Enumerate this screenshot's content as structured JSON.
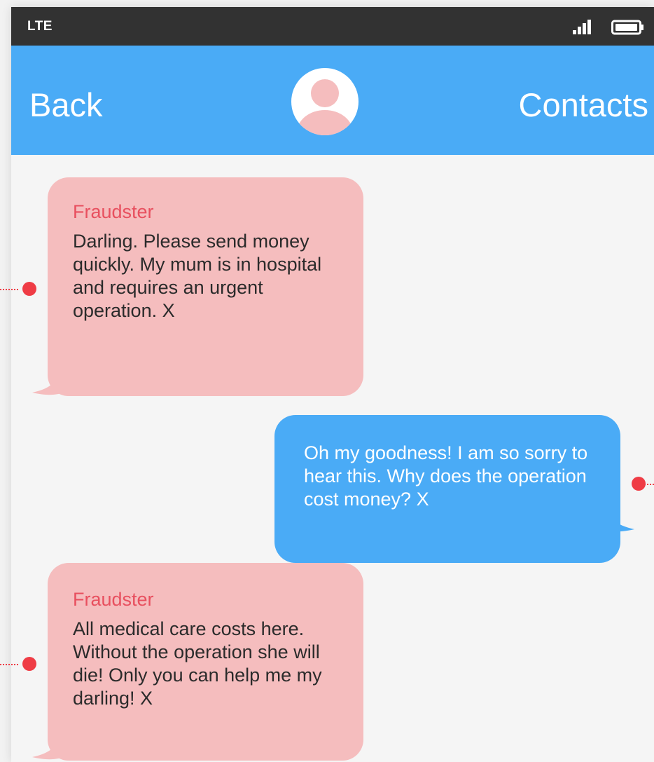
{
  "status_bar": {
    "carrier": "LTE",
    "signal_icon": "signal-bars-icon",
    "battery_icon": "battery-icon"
  },
  "nav": {
    "back_label": "Back",
    "contacts_label": "Contacts",
    "avatar_icon": "contact-avatar-icon"
  },
  "messages": [
    {
      "direction": "incoming",
      "sender": "Fraudster",
      "text": "Darling. Please send money quickly. My mum is in hospital and requires an urgent operation. X"
    },
    {
      "direction": "outgoing",
      "sender": "",
      "text": "Oh my goodness! I am so sorry to hear this. Why does the operation cost money? X"
    },
    {
      "direction": "incoming",
      "sender": "Fraudster",
      "text": "All medical care costs here. Without the operation she will die! Only you can help me my darling! X"
    }
  ],
  "colors": {
    "status_bar": "#323232",
    "nav_bar": "#4aabf6",
    "incoming_bubble": "#f5bdbe",
    "outgoing_bubble": "#4aabf6",
    "sender_name": "#e8505f",
    "annotation_pin": "#ef3c45",
    "avatar_silhouette": "#f5bdbe"
  }
}
